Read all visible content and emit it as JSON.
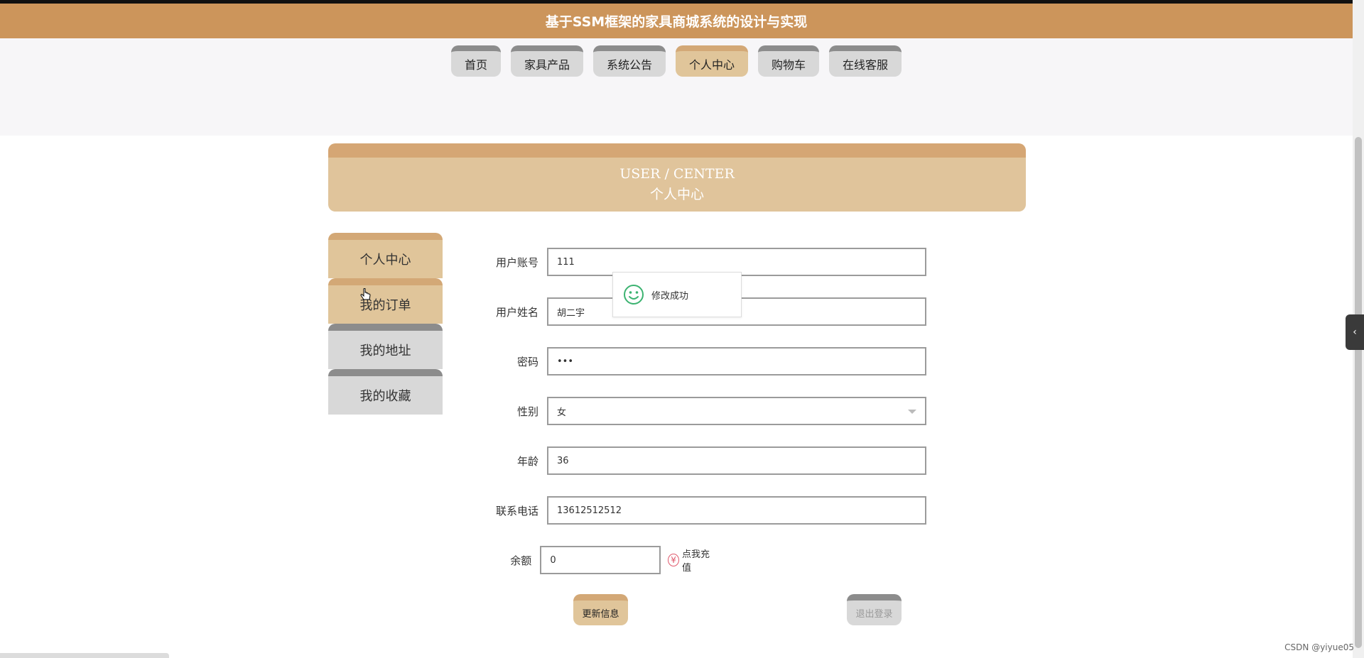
{
  "header": {
    "title": "基于SSM框架的家具商城系统的设计与实现"
  },
  "nav": {
    "items": [
      "首页",
      "家具产品",
      "系统公告",
      "个人中心",
      "购物车",
      "在线客服"
    ],
    "active_index": 3
  },
  "banner": {
    "en": "USER / CENTER",
    "cn": "个人中心"
  },
  "sidebar": {
    "items": [
      {
        "label": "个人中心"
      },
      {
        "label": "我的订单"
      },
      {
        "label": "我的地址"
      },
      {
        "label": "我的收藏"
      }
    ]
  },
  "form": {
    "account": {
      "label": "用户账号",
      "value": "111"
    },
    "name": {
      "label": "用户姓名",
      "value": "胡二宇"
    },
    "password": {
      "label": "密码",
      "value": "•••"
    },
    "gender": {
      "label": "性别",
      "value": "女"
    },
    "age": {
      "label": "年龄",
      "value": "36"
    },
    "phone": {
      "label": "联系电话",
      "value": "13612512512"
    },
    "balance": {
      "label": "余额",
      "value": "0"
    },
    "recharge_label": "点我充值",
    "recharge_icon": "yen-icon"
  },
  "buttons": {
    "update": "更新信息",
    "logout": "退出登录"
  },
  "toast": {
    "message": "修改成功",
    "icon": "smile-icon"
  },
  "watermark": "CSDN @yiyue05",
  "colors": {
    "brand": "#cc955b",
    "accent": "#e0c59a",
    "toast_icon": "#3cb371"
  }
}
